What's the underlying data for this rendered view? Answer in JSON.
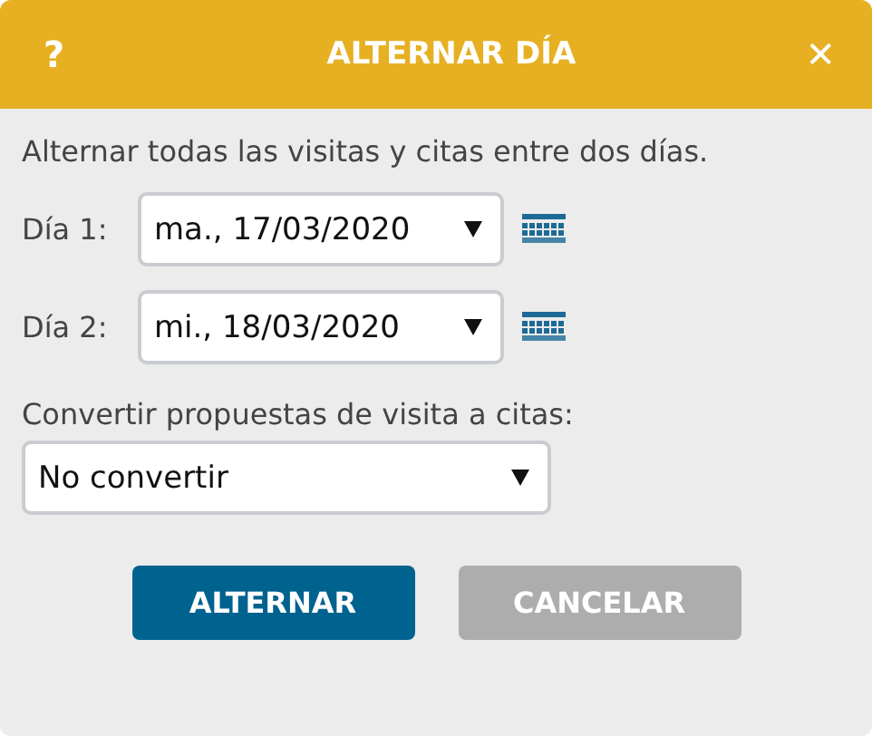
{
  "dialog": {
    "title": "ALTERNAR DÍA",
    "help": "?",
    "close": "✕"
  },
  "intro": "Alternar todas las visitas y citas entre dos días.",
  "days": [
    {
      "label": "Día 1:",
      "value": "ma., 17/03/2020"
    },
    {
      "label": "Día 2:",
      "value": "mi., 18/03/2020"
    }
  ],
  "convert": {
    "label": "Convertir propuestas de visita a citas:",
    "value": "No convertir"
  },
  "buttons": [
    {
      "label": "ALTERNAR",
      "kind": "primary"
    },
    {
      "label": "CANCELAR",
      "kind": "secondary"
    }
  ]
}
